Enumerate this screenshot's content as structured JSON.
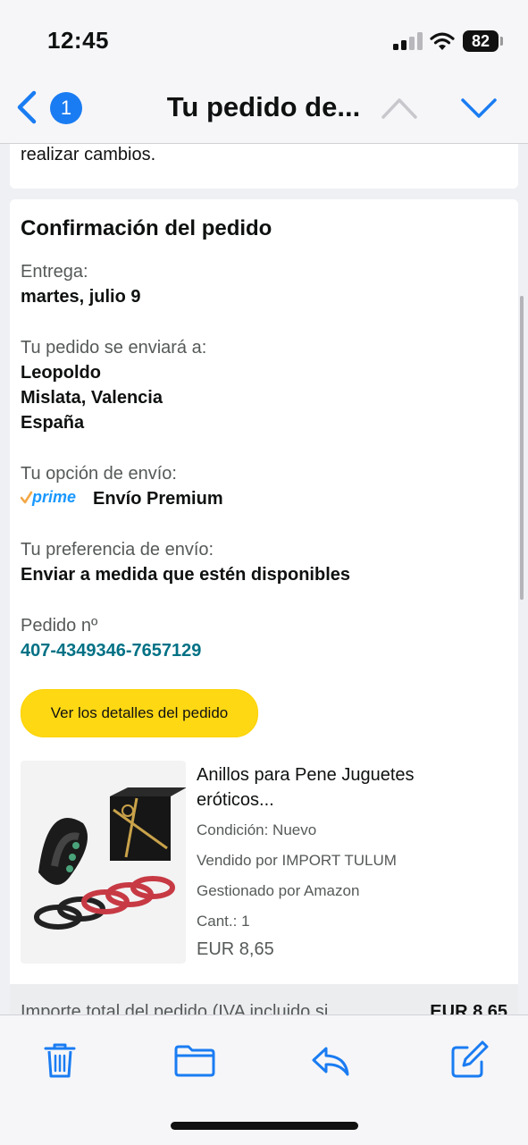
{
  "status": {
    "time": "12:45",
    "battery": "82"
  },
  "nav": {
    "badge": "1",
    "title": "Tu pedido de..."
  },
  "email": {
    "prev_text": "realizar cambios.",
    "heading": "Confirmación del pedido",
    "delivery_label": "Entrega:",
    "delivery_value": "martes, julio 9",
    "ship_to_label": "Tu pedido se enviará a:",
    "ship_to_name": "Leopoldo",
    "ship_to_city": "Mislata, Valencia",
    "ship_to_country": "España",
    "ship_option_label": "Tu opción de envío:",
    "ship_option_logo": "prime",
    "ship_option_value": "Envío Premium",
    "ship_pref_label": "Tu preferencia de envío:",
    "ship_pref_value": "Enviar a medida que estén disponibles",
    "order_label": "Pedido nº",
    "order_number": "407-4349346-7657129",
    "details_button": "Ver los detalles del pedido",
    "product": {
      "name": "Anillos para Pene Juguetes eróticos...",
      "condition": "Condición: Nuevo",
      "seller": "Vendido por IMPORT TULUM",
      "fulfilled": "Gestionado por Amazon",
      "qty": "Cant.: 1",
      "price": "EUR 8,65"
    },
    "total_label": "Importe total del pedido (IVA incluido si",
    "total_value": "EUR 8,65"
  },
  "colors": {
    "accent_blue": "#1a7cf2",
    "link_teal": "#007185",
    "button_yellow": "#ffd814",
    "prime_blue": "#1a98ff",
    "prime_check": "#f3a847"
  },
  "icons": {
    "toolbar": [
      "trash-icon",
      "folder-icon",
      "reply-icon",
      "compose-icon"
    ]
  }
}
